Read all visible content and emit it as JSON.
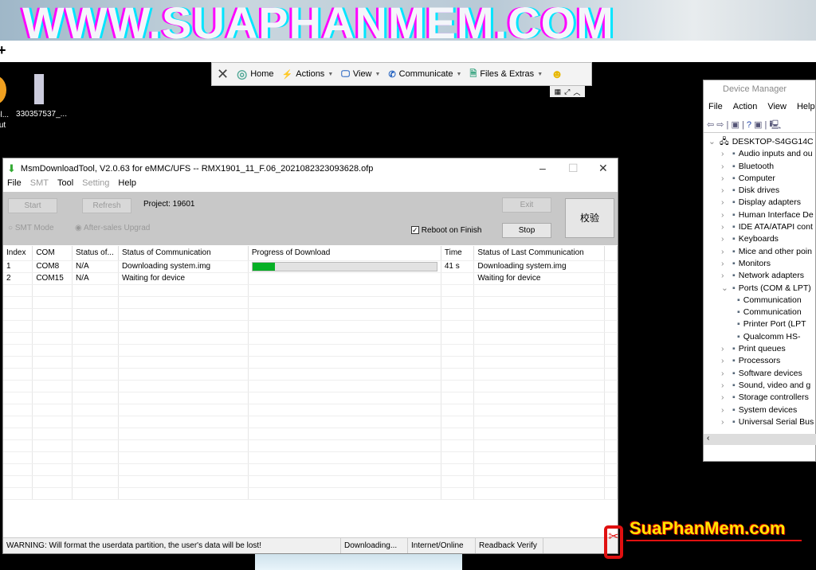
{
  "banner": {
    "text": "WWW.SUAPHANMEM.COM"
  },
  "desktop": {
    "icons": [
      {
        "label": "ol...\nut"
      },
      {
        "label": "330357537_..."
      }
    ]
  },
  "teamviewer": {
    "items": [
      {
        "label": "Home",
        "icon": "home-icon"
      },
      {
        "label": "Actions",
        "icon": "lightning-icon"
      },
      {
        "label": "View",
        "icon": "monitor-icon"
      },
      {
        "label": "Communicate",
        "icon": "phone-chat-icon"
      },
      {
        "label": "Files & Extras",
        "icon": "file-icon"
      }
    ]
  },
  "device_manager": {
    "title": "Device Manager",
    "menu": [
      "File",
      "Action",
      "View",
      "Help"
    ],
    "root": "DESKTOP-S4GG14C",
    "items": [
      {
        "label": "Audio inputs and ou",
        "expanded": false,
        "child": false
      },
      {
        "label": "Bluetooth",
        "child": false
      },
      {
        "label": "Computer",
        "child": false
      },
      {
        "label": "Disk drives",
        "child": false
      },
      {
        "label": "Display adapters",
        "child": false
      },
      {
        "label": "Human Interface De",
        "child": false
      },
      {
        "label": "IDE ATA/ATAPI cont",
        "child": false
      },
      {
        "label": "Keyboards",
        "child": false
      },
      {
        "label": "Mice and other poin",
        "child": false
      },
      {
        "label": "Monitors",
        "child": false
      },
      {
        "label": "Network adapters",
        "child": false
      },
      {
        "label": "Ports (COM & LPT)",
        "expanded": true,
        "child": false
      },
      {
        "label": "Communication",
        "child": true
      },
      {
        "label": "Communication",
        "child": true
      },
      {
        "label": "Printer Port (LPT",
        "child": true
      },
      {
        "label": "Qualcomm HS-",
        "child": true
      },
      {
        "label": "Print queues",
        "child": false
      },
      {
        "label": "Processors",
        "child": false
      },
      {
        "label": "Software devices",
        "child": false
      },
      {
        "label": "Sound, video and g",
        "child": false
      },
      {
        "label": "Storage controllers",
        "child": false
      },
      {
        "label": "System devices",
        "child": false
      },
      {
        "label": "Universal Serial Bus",
        "child": false
      }
    ]
  },
  "msm": {
    "title": "MsmDownloadTool, V2.0.63 for eMMC/UFS -- RMX1901_11_F.06_2021082323093628.ofp",
    "menu": [
      "File",
      "SMT",
      "Tool",
      "Setting",
      "Help"
    ],
    "start": "Start",
    "refresh": "Refresh",
    "project": "Project: 19601",
    "exit": "Exit",
    "verify": "校验",
    "stop": "Stop",
    "smt_mode": "SMT Mode",
    "after_sales": "After-sales Upgrad",
    "reboot": "Reboot on Finish",
    "reboot_checked": true,
    "columns": [
      "Index",
      "COM",
      "Status of...",
      "Status of Communication",
      "Progress of Download",
      "Time",
      "Status of Last Communication"
    ],
    "rows": [
      {
        "index": "1",
        "com": "COM8",
        "status": "N/A",
        "comm": "Downloading system.img",
        "progress": 12,
        "time": "41 s",
        "last": "Downloading system.img"
      },
      {
        "index": "2",
        "com": "COM15",
        "status": "N/A",
        "comm": "Waiting for device",
        "progress": null,
        "time": "",
        "last": "Waiting for device"
      }
    ],
    "status_bar": [
      "WARNING: Will format the userdata partition, the user's data will be lost!",
      "Downloading...",
      "Internet/Online",
      "Readback Verify"
    ],
    "progress_color": "#06b025"
  },
  "watermark": {
    "text": "SuaPhanMem.com"
  }
}
